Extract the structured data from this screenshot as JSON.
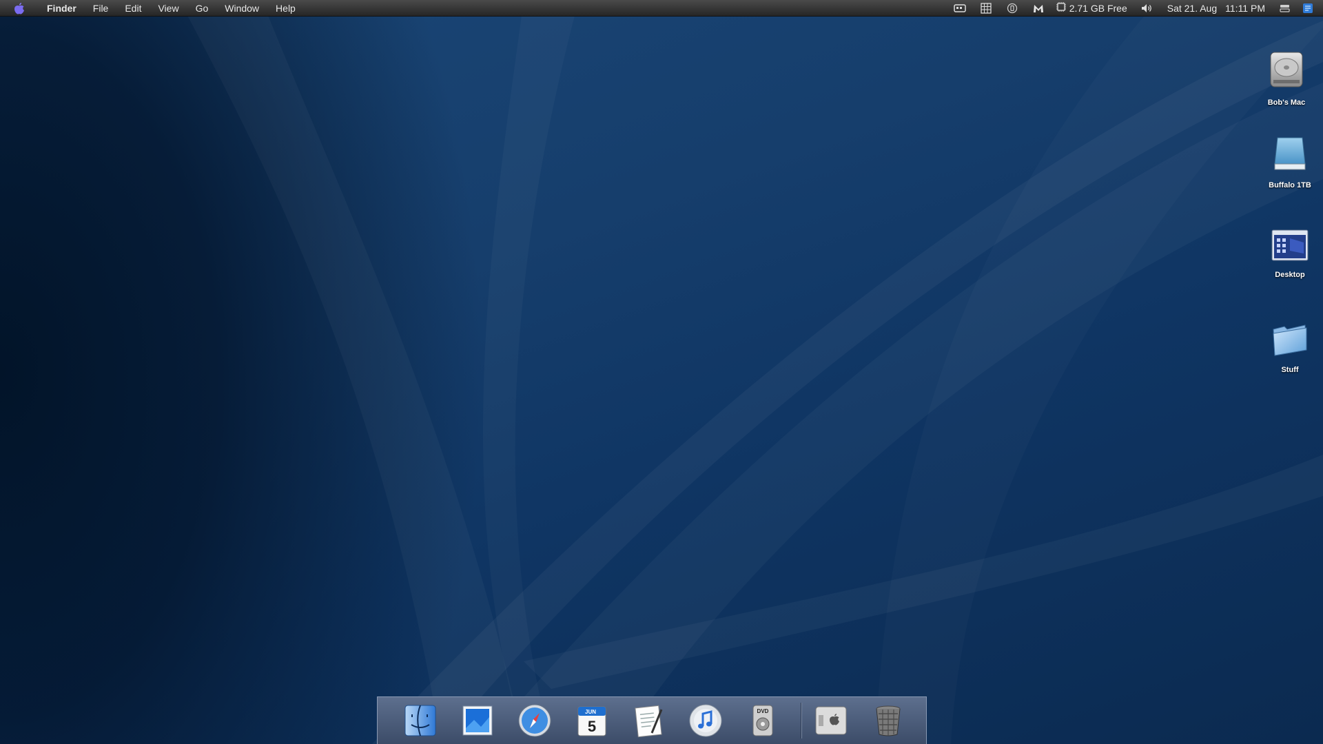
{
  "menubar": {
    "app_name": "Finder",
    "menus": [
      "File",
      "Edit",
      "View",
      "Go",
      "Window",
      "Help"
    ],
    "status_icons": [
      "keyboard-icon",
      "grid-icon",
      "timemachine-icon",
      "malwarebytes-icon"
    ],
    "disk_free": "2.71 GB Free",
    "date": "Sat 21. Aug",
    "time": "11:11 PM"
  },
  "desktop_icons": [
    {
      "label": "Bob's Mac",
      "icon": "hard-drive-icon"
    },
    {
      "label": "Buffalo 1TB",
      "icon": "external-drive-icon"
    },
    {
      "label": "Desktop",
      "icon": "desktop-folder-icon"
    },
    {
      "label": "Stuff",
      "icon": "folder-icon"
    }
  ],
  "dock": {
    "items": [
      "finder-icon",
      "preview-icon",
      "safari-icon",
      "ical-icon",
      "textedit-icon",
      "itunes-icon",
      "dvd-player-icon",
      "system-preferences-icon",
      "trash-icon"
    ],
    "calendar_day": "5",
    "calendar_month": "JUN",
    "dvd_label": "DVD"
  },
  "colors": {
    "wallpaper": "#163e6c",
    "menubar": "#333333",
    "dock": "#4c5d7b"
  }
}
